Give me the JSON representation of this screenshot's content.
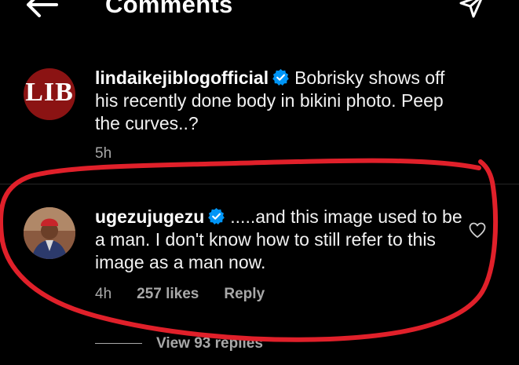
{
  "header": {
    "title": "Comments",
    "back_icon": "arrow-left-icon",
    "share_icon": "paper-plane-icon"
  },
  "post_caption": {
    "avatar_text": "LIB",
    "avatar_color": "#8b1313",
    "username": "lindaikejiblogofficial",
    "verified": true,
    "body": "Bobrisky shows off his recently done body in bikini photo. Peep the curves..?",
    "time": "5h"
  },
  "comment": {
    "username": "ugezujugezu",
    "verified": true,
    "body": ".....and this image used to be a man. I don't know how to still refer to this image as a man now.",
    "time": "4h",
    "likes": "257 likes",
    "reply_label": "Reply",
    "like_icon": "heart-outline-icon"
  },
  "replies": {
    "label": "View 93 replies"
  },
  "colors": {
    "background": "#000000",
    "text": "#f2f2f2",
    "muted": "#a8a8a8",
    "verified_blue": "#0095f6",
    "annotation_red": "#e0202a"
  }
}
